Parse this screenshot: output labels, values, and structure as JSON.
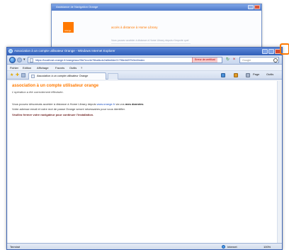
{
  "background_dialog": {
    "title": "Assistance de Navigation Orange",
    "logo_text": "orange",
    "heading": "accès à distance à Home Library",
    "text": "Vous pouvez accéder à distance à Home Library depuis n'importe quel"
  },
  "browser": {
    "window_title": "Association à un compte utilisateur Orange - Windows Internet Explorer",
    "url": "https://localhost.orange.fr/orangesso/9fa7ecc4e76ba8cdc2a6be6de21796e4d2f7b0e4/index",
    "cert_error": "Erreur de certificat",
    "search_placeholder": "Google",
    "menu": [
      "Fichier",
      "Edition",
      "Affichage",
      "Favoris",
      "Outils",
      "?"
    ],
    "tab_label": "Association à un compte utilisateur Orange",
    "commands": [
      "Page",
      "Outils"
    ],
    "status_left": "Terminé",
    "status_zone": "Internet",
    "zoom": "100%"
  },
  "page": {
    "title": "association à un compte utilisateur orange",
    "p1": "L'opération a été correctement éffectuée.",
    "p2_prefix": "Vous pouvez désormais accéder à distance à Home Library depuis ",
    "p2_link": "www.orange.fr",
    "p2_suffix": " via vos ",
    "p2_bold": "mes données",
    "p3": "Votre adresse email et votre mot de passe Orange seront nécessaires pour vous identifier.",
    "p4": "Veuillez fermer votre navigateur pour continuer l'installation."
  },
  "colors": {
    "accent": "#ff7900",
    "titlebar": "#2f5eb8",
    "cert_error": "#b40000"
  }
}
